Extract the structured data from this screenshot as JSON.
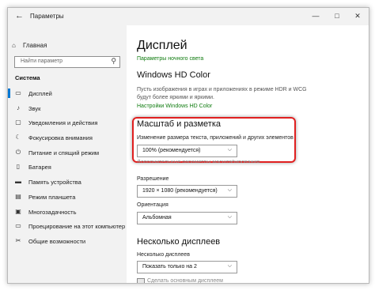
{
  "window": {
    "title": "Параметры",
    "back_glyph": "←",
    "minimize_glyph": "—",
    "maximize_glyph": "□",
    "close_glyph": "✕"
  },
  "sidebar": {
    "home_label": "Главная",
    "home_icon": "⌂",
    "search_placeholder": "Найти параметр",
    "search_icon": "⚲",
    "section_heading": "Система",
    "items": [
      {
        "label": "Дисплей",
        "icon": "▭",
        "active": true
      },
      {
        "label": "Звук",
        "icon": "♪"
      },
      {
        "label": "Уведомления и действия",
        "icon": "▢"
      },
      {
        "label": "Фокусировка внимания",
        "icon": "☾"
      },
      {
        "label": "Питание и спящий режим",
        "icon": "⏻"
      },
      {
        "label": "Батарея",
        "icon": "▯"
      },
      {
        "label": "Память устройства",
        "icon": "▬"
      },
      {
        "label": "Режим планшета",
        "icon": "▤"
      },
      {
        "label": "Многозадачность",
        "icon": "▣"
      },
      {
        "label": "Проецирование на этот компьютер",
        "icon": "▭"
      },
      {
        "label": "Общие возможности",
        "icon": "✂"
      }
    ]
  },
  "main": {
    "title": "Дисплей",
    "night_light_link": "Параметры ночного света",
    "hdr_heading": "Windows HD Color",
    "hdr_description": "Пусть изображения в играх и приложениях в режиме HDR и WCG будут более яркими и яркими.",
    "hdr_link": "Настройки Windows HD Color",
    "scale_heading": "Масштаб и разметка",
    "scale_label": "Изменение размера текста, приложений и других элементов",
    "scale_value": "100% (рекомендуется)",
    "advanced_scaling_link": "Дополнительные параметры масштабирования",
    "resolution_label": "Разрешение",
    "resolution_value": "1920 × 1080 (рекомендуется)",
    "orientation_label": "Ориентация",
    "orientation_value": "Альбомная",
    "multi_heading": "Несколько дисплеев",
    "multi_label": "Несколько дисплеев",
    "multi_value": "Показать только на 2",
    "make_main_label": "Сделать основным дисплеем",
    "chevron": "⌵"
  },
  "colors": {
    "accent": "#0078d4",
    "link": "#107c10",
    "highlight": "#e02020"
  }
}
